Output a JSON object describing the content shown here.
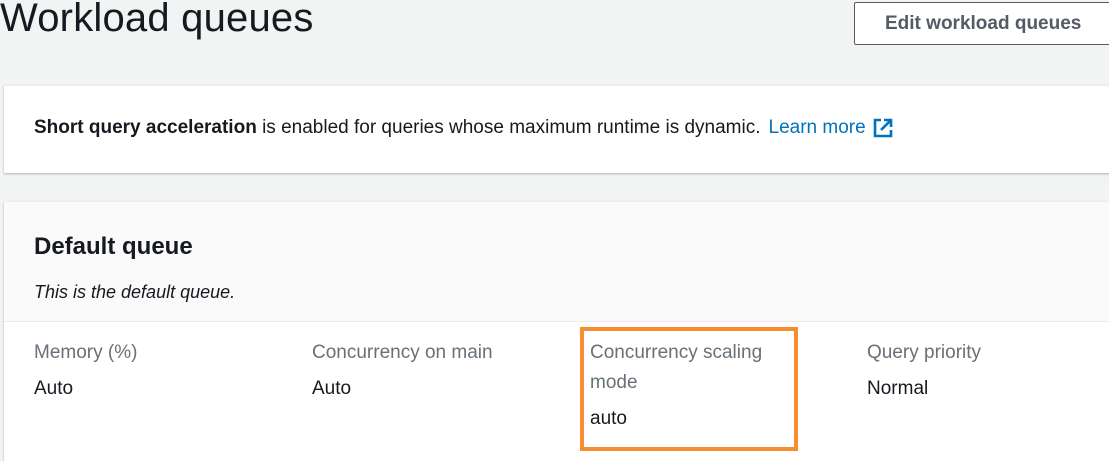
{
  "header": {
    "title": "Workload queues",
    "edit_button_label": "Edit workload queues"
  },
  "sqa_banner": {
    "bold_text": "Short query acceleration",
    "text": " is enabled for queries whose maximum runtime is dynamic.",
    "link_label": "Learn more",
    "link_icon": "external-link-icon",
    "link_color": "#0073bb"
  },
  "queue": {
    "title": "Default queue",
    "description": "This is the default queue.",
    "properties": [
      {
        "label": "Memory (%)",
        "value": "Auto"
      },
      {
        "label": "Concurrency on main",
        "value": "Auto"
      },
      {
        "label": "Concurrency scaling mode",
        "value": "auto"
      },
      {
        "label": "Query priority",
        "value": "Normal"
      }
    ]
  },
  "colors": {
    "highlight": "#f68d2e",
    "background": "#f2f3f3",
    "label": "#687078"
  }
}
